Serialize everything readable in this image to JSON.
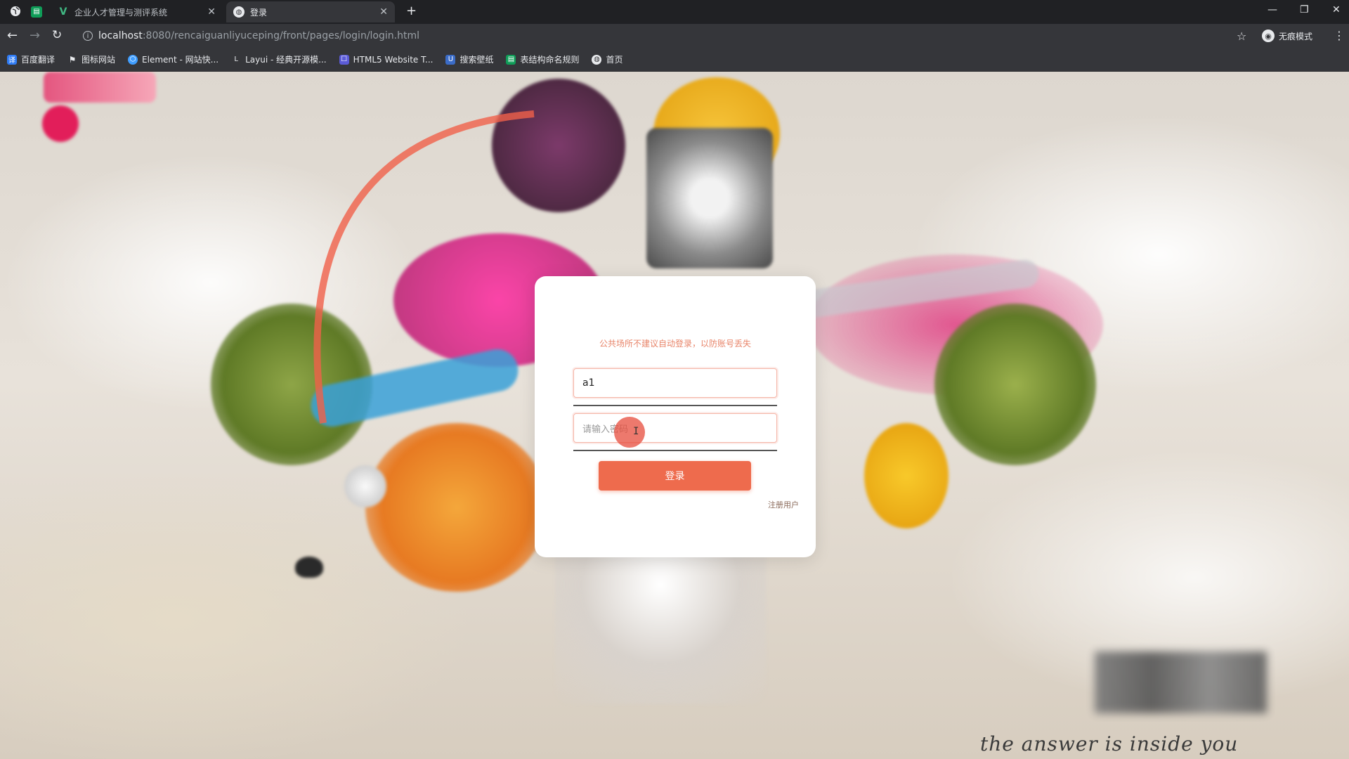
{
  "browser": {
    "tabs": [
      {
        "title": "企业人才管理与测评系统",
        "favicon": "vue-icon",
        "active": false
      },
      {
        "title": "登录",
        "favicon": "globe-icon",
        "active": true
      }
    ],
    "new_tab": "+",
    "address": {
      "host": "localhost",
      "path": ":8080/rencaiguanliyuceping/front/pages/login/login.html"
    },
    "profile_label": "无痕模式",
    "bookmarks": [
      {
        "label": "百度翻译",
        "icon": "translate-icon",
        "color": "#2f7cf6"
      },
      {
        "label": "图标网站",
        "icon": "flag-icon",
        "color": "#555555"
      },
      {
        "label": "Element - 网站快...",
        "icon": "element-icon",
        "color": "#409eff"
      },
      {
        "label": "Layui - 经典开源模...",
        "icon": "layui-icon",
        "color": "#555555"
      },
      {
        "label": "HTML5 Website T...",
        "icon": "html5-icon",
        "color": "#5b5bd6"
      },
      {
        "label": "搜索壁纸",
        "icon": "wallpaper-icon",
        "color": "#3b6cc7"
      },
      {
        "label": "表结构命名规则",
        "icon": "sheet-icon",
        "color": "#0f9d58"
      },
      {
        "label": "首页",
        "icon": "globe-icon",
        "color": "#e8eaed"
      }
    ]
  },
  "login": {
    "tip": "公共场所不建议自动登录，以防账号丢失",
    "username_value": "a1",
    "password_placeholder": "请输入密码",
    "submit_label": "登录",
    "register_label": "注册用户"
  },
  "background": {
    "tagline": "the answer is inside you"
  },
  "colors": {
    "accent": "#ee6b4d",
    "tip": "#e8856a",
    "chrome_dark": "#202124",
    "chrome": "#35363a"
  }
}
